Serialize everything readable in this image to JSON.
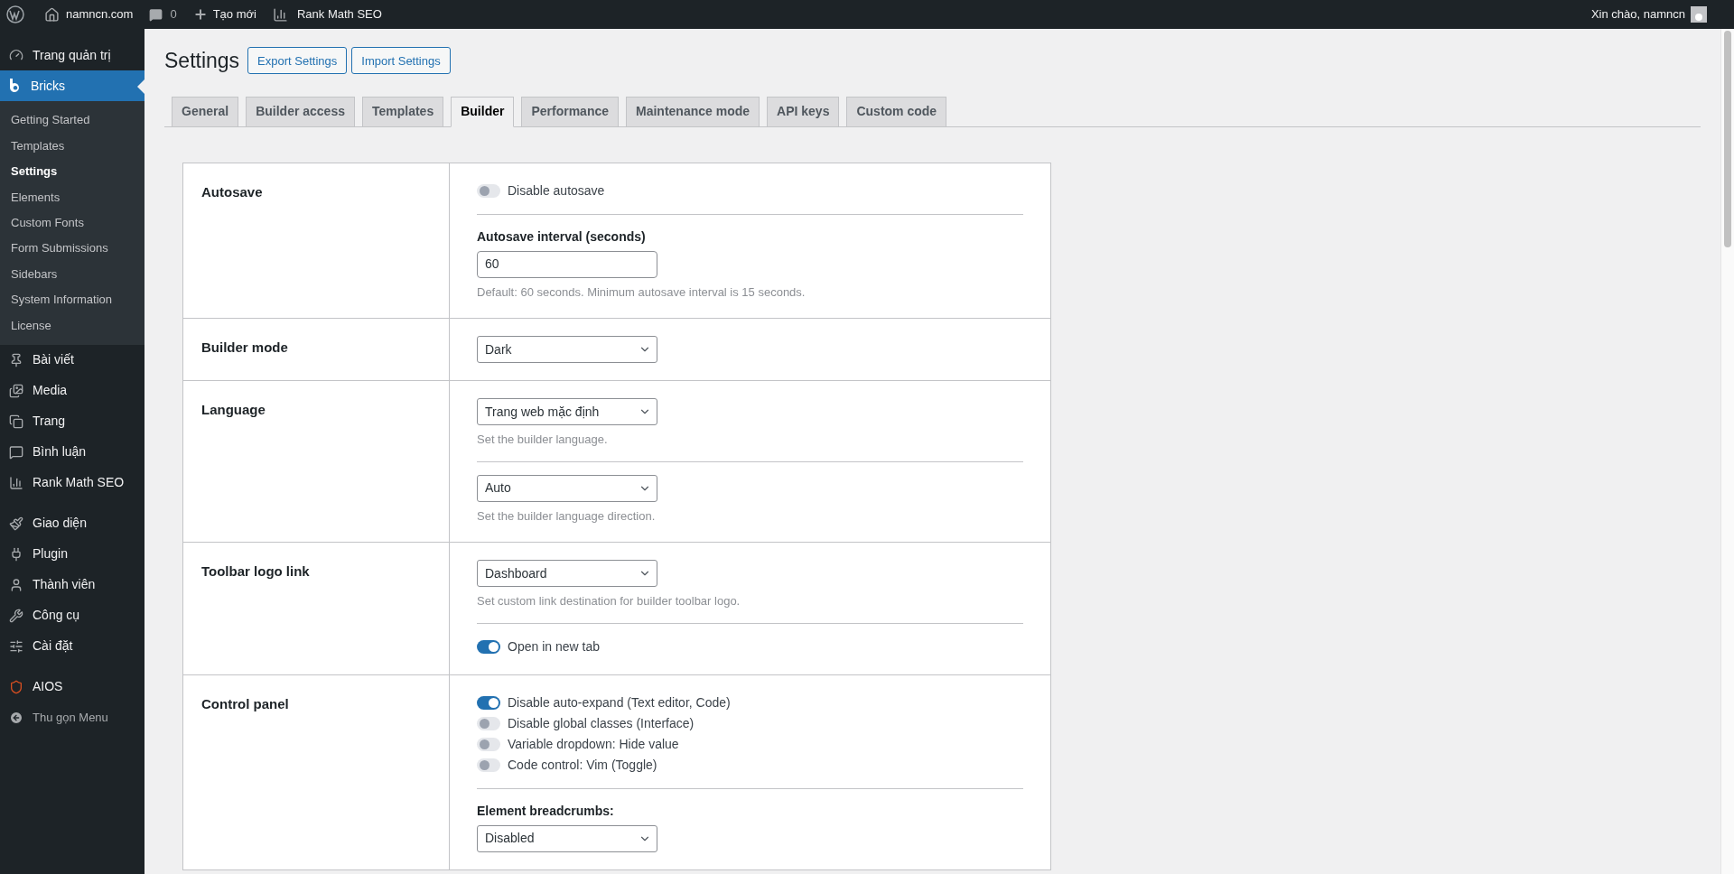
{
  "admin_bar": {
    "site": "namncn.com",
    "comments": "0",
    "new": "Tạo mới",
    "seo": "Rank Math SEO",
    "greeting": "Xin chào, namncn"
  },
  "sidebar": {
    "groups": [
      [
        {
          "label": "Trang quản trị",
          "selected": false
        },
        {
          "label": "Bricks",
          "selected": true,
          "children": [
            {
              "label": "Getting Started",
              "selected": false
            },
            {
              "label": "Templates",
              "selected": false
            },
            {
              "label": "Settings",
              "selected": true
            },
            {
              "label": "Elements",
              "selected": false
            },
            {
              "label": "Custom Fonts",
              "selected": false
            },
            {
              "label": "Form Submissions",
              "selected": false
            },
            {
              "label": "Sidebars",
              "selected": false
            },
            {
              "label": "System Information",
              "selected": false
            },
            {
              "label": "License",
              "selected": false
            }
          ]
        },
        {
          "label": "Bài viết",
          "selected": false
        },
        {
          "label": "Media",
          "selected": false
        },
        {
          "label": "Trang",
          "selected": false
        },
        {
          "label": "Bình luận",
          "selected": false
        },
        {
          "label": "Rank Math SEO",
          "selected": false
        }
      ],
      [
        {
          "label": "Giao diện",
          "selected": false
        },
        {
          "label": "Plugin",
          "selected": false
        },
        {
          "label": "Thành viên",
          "selected": false
        },
        {
          "label": "Công cụ",
          "selected": false
        },
        {
          "label": "Cài đặt",
          "selected": false
        }
      ],
      [
        {
          "label": "AIOS",
          "selected": false
        }
      ]
    ],
    "collapse": "Thu gọn Menu"
  },
  "page": {
    "title": "Settings",
    "buttons": [
      "Export Settings",
      "Import Settings"
    ]
  },
  "tabs": [
    {
      "label": "General",
      "selected": false
    },
    {
      "label": "Builder access",
      "selected": false
    },
    {
      "label": "Templates",
      "selected": false
    },
    {
      "label": "Builder",
      "selected": true
    },
    {
      "label": "Performance",
      "selected": false
    },
    {
      "label": "Maintenance mode",
      "selected": false
    },
    {
      "label": "API keys",
      "selected": false
    },
    {
      "label": "Custom code",
      "selected": false
    }
  ],
  "sections": [
    {
      "label": "Autosave",
      "groups": [
        [
          {
            "kind": "toggle",
            "label": "Disable autosave",
            "on": false
          }
        ],
        [
          {
            "kind": "input",
            "label": "Autosave interval (seconds)",
            "value": "60",
            "hint": "Default: 60 seconds. Minimum autosave interval is 15 seconds."
          }
        ]
      ]
    },
    {
      "label": "Builder mode",
      "groups": [
        [
          {
            "kind": "select",
            "value": "Dark"
          }
        ]
      ]
    },
    {
      "label": "Language",
      "groups": [
        [
          {
            "kind": "select",
            "value": "Trang web mặc định",
            "hint": "Set the builder language."
          }
        ],
        [
          {
            "kind": "select",
            "value": "Auto",
            "hint": "Set the builder language direction."
          }
        ]
      ]
    },
    {
      "label": "Toolbar logo link",
      "groups": [
        [
          {
            "kind": "select",
            "value": "Dashboard",
            "hint": "Set custom link destination for builder toolbar logo."
          }
        ],
        [
          {
            "kind": "toggle",
            "label": "Open in new tab",
            "on": true
          }
        ]
      ]
    },
    {
      "label": "Control panel",
      "groups": [
        [
          {
            "kind": "toggle",
            "label": "Disable auto-expand (Text editor, Code)",
            "on": true
          },
          {
            "kind": "toggle",
            "label": "Disable global classes (Interface)",
            "on": false
          },
          {
            "kind": "toggle",
            "label": "Variable dropdown: Hide value",
            "on": false
          },
          {
            "kind": "toggle",
            "label": "Code control: Vim (Toggle)",
            "on": false
          }
        ],
        [
          {
            "kind": "select",
            "label": "Element breadcrumbs:",
            "value": "Disabled"
          }
        ]
      ]
    }
  ]
}
